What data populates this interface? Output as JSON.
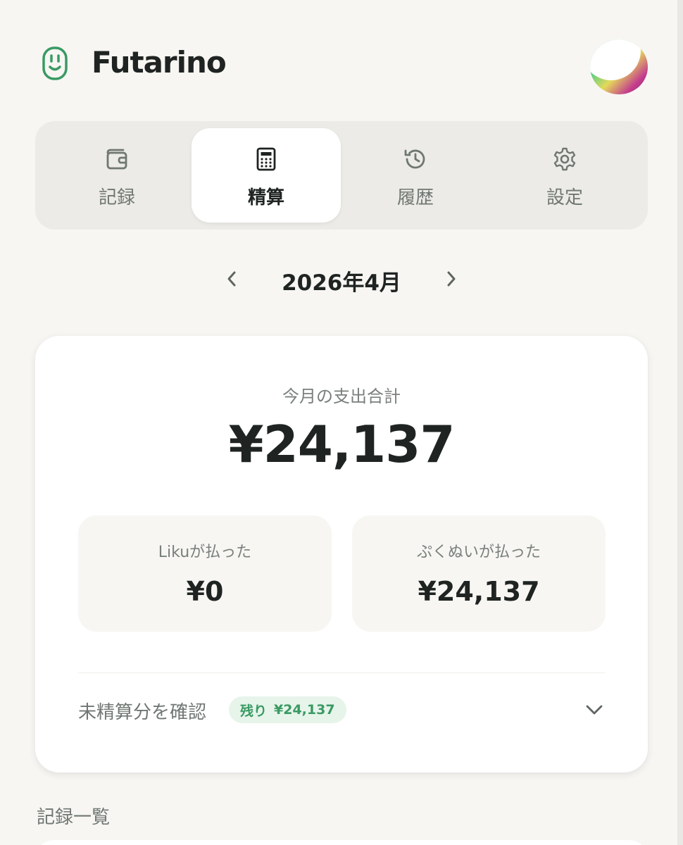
{
  "header": {
    "app_title": "Futarino",
    "logo_icon": "smile-badge-icon",
    "avatar_icon": "user-avatar"
  },
  "tabs": [
    {
      "label": "記録",
      "icon": "wallet-icon",
      "active": false
    },
    {
      "label": "精算",
      "icon": "calculator-icon",
      "active": true
    },
    {
      "label": "履歴",
      "icon": "history-icon",
      "active": false
    },
    {
      "label": "設定",
      "icon": "gear-icon",
      "active": false
    }
  ],
  "month_nav": {
    "label": "2026年4月",
    "prev_icon": "chevron-left-icon",
    "next_icon": "chevron-right-icon"
  },
  "summary": {
    "total_label": "今月の支出合計",
    "total_value": "¥24,137",
    "payers": [
      {
        "label": "Likuが払った",
        "amount": "¥0"
      },
      {
        "label": "ぷくぬいが払った",
        "amount": "¥24,137"
      }
    ],
    "unsettled": {
      "label": "未精算分を確認",
      "badge_prefix": "残り",
      "badge_amount": "¥24,137",
      "toggle_icon": "chevron-down-icon"
    }
  },
  "records": {
    "title": "記録一覧"
  },
  "colors": {
    "background": "#f7f6f3",
    "accent_green": "#3a9a63",
    "badge_bg": "#e6f4ea",
    "text_dark": "#1f2422",
    "text_muted": "#707772"
  }
}
